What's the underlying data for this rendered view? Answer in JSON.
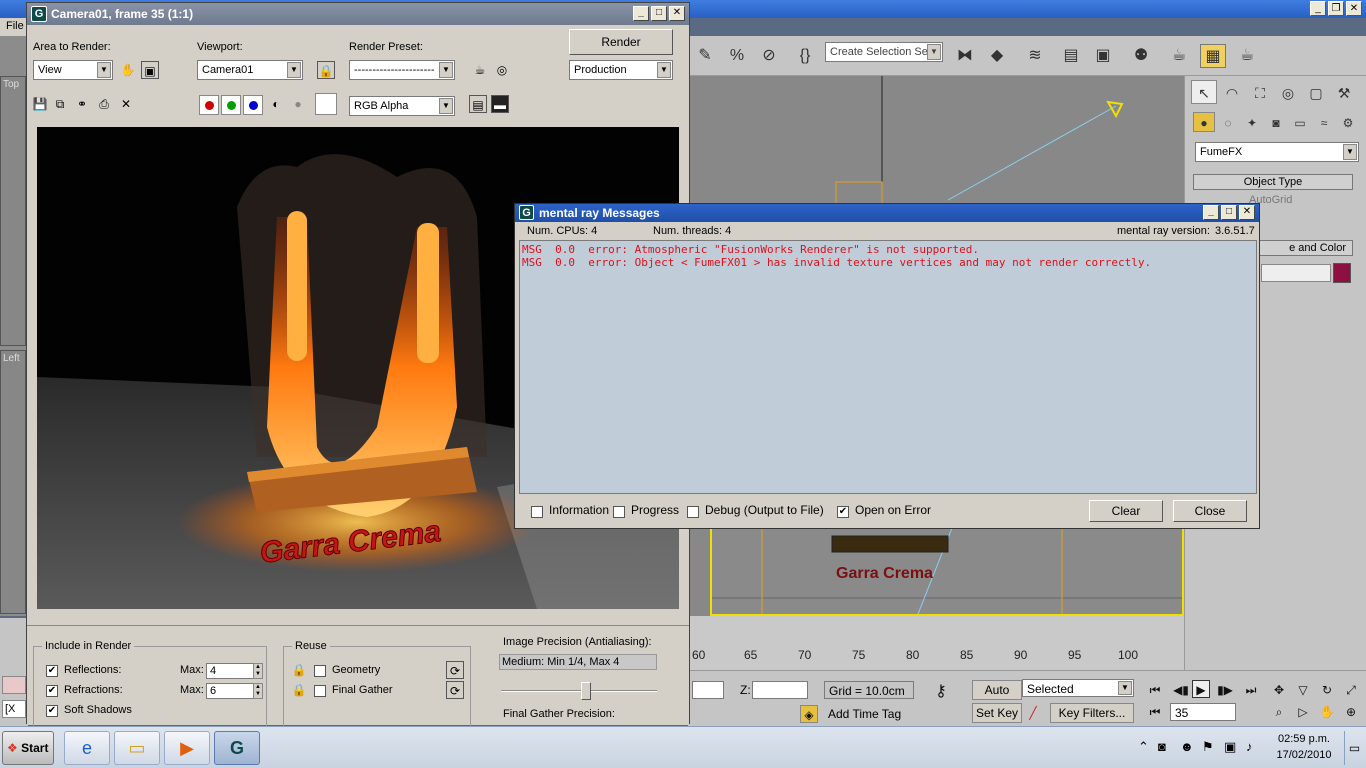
{
  "max": {
    "menu_file": "File",
    "selection_set_placeholder": "Create Selection Set",
    "left_viewports": [
      "Top",
      "Left"
    ],
    "left_x_field": "[X",
    "command_panel": {
      "object_category": "FumeFX",
      "object_type_header": "Object Type",
      "autogrid_label": "AutoGrid",
      "name_color_header": "e and Color",
      "swatch_color": "#8e1040"
    },
    "timeline_ticks": [
      "60",
      "65",
      "70",
      "75",
      "80",
      "85",
      "90",
      "95",
      "100"
    ],
    "status": {
      "z_label": "Z:",
      "grid_text": "Grid = 10.0cm",
      "auto_key": "Auto Key",
      "set_key": "Set Key",
      "key_mode": "Selected",
      "key_filters": "Key Filters...",
      "add_time_tag": "Add Time Tag",
      "frame": "35"
    }
  },
  "render_window": {
    "title": "Camera01, frame 35 (1:1)",
    "area_to_render_label": "Area to Render:",
    "area_to_render_value": "View",
    "viewport_label": "Viewport:",
    "viewport_value": "Camera01",
    "preset_label": "Render Preset:",
    "preset_value": "----------------------",
    "render_button": "Render",
    "render_mode": "Production",
    "channel": "RGB Alpha",
    "image": {
      "text": "Garra Crema"
    },
    "include_in_render": {
      "title": "Include in Render",
      "reflections": "Reflections:",
      "refractions": "Refractions:",
      "soft_shadows": "Soft Shadows",
      "max_label": "Max:",
      "reflections_max": "4",
      "refractions_max": "6"
    },
    "reuse": {
      "title": "Reuse",
      "geometry": "Geometry",
      "final_gather": "Final Gather"
    },
    "precision": {
      "title": "Image Precision (Antialiasing):",
      "value": "Medium: Min 1/4, Max 4",
      "slider_fraction": 0.55,
      "fg_title": "Final Gather Precision:"
    }
  },
  "mr_messages": {
    "title": "mental ray Messages",
    "num_cpus": "Num. CPUs: 4",
    "num_threads": "Num. threads: 4",
    "version_label": "mental ray version:",
    "version": "3.6.51.7",
    "messages": [
      "MSG  0.0  error: Atmospheric \"FusionWorks Renderer\" is not supported.",
      "MSG  0.0  error: Object < FumeFX01 > has invalid texture vertices and may not render correctly."
    ],
    "options": {
      "information": "Information",
      "progress": "Progress",
      "debug": "Debug (Output to File)",
      "open_on_error": "Open on Error"
    },
    "clear": "Clear",
    "close": "Close"
  },
  "taskbar": {
    "start": "Start",
    "time": "02:59 p.m.",
    "date": "17/02/2010"
  }
}
